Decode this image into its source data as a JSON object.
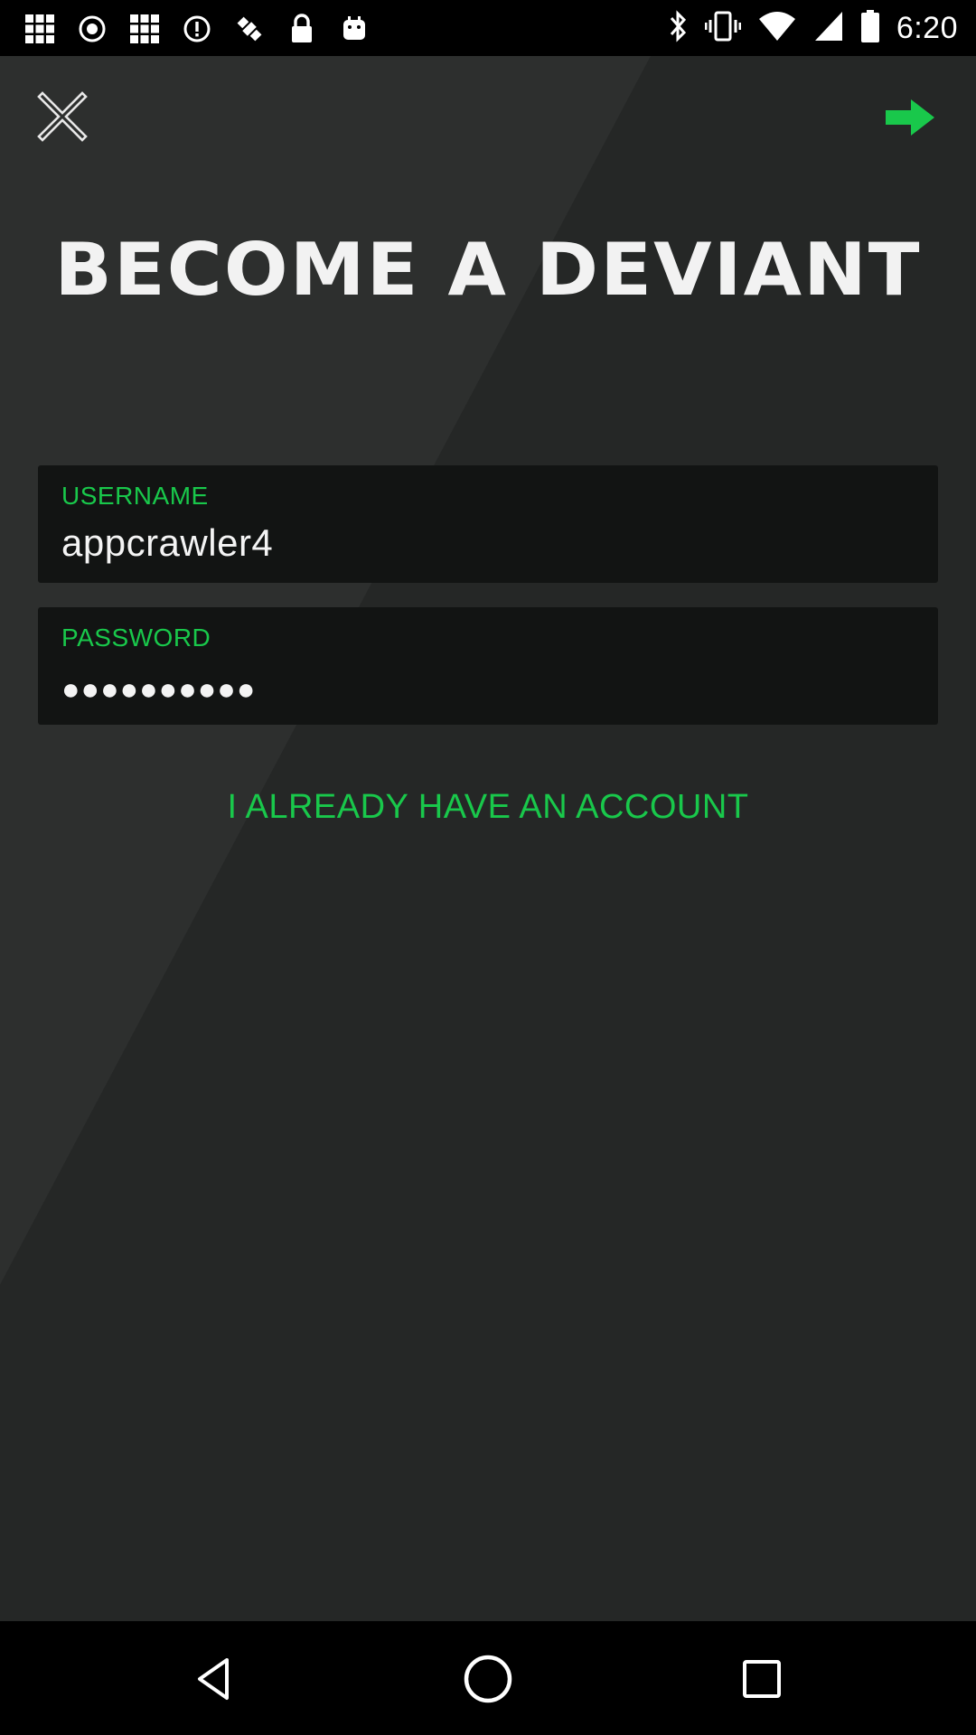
{
  "status_bar": {
    "time": "6:20",
    "left_icons": [
      "grid-icon",
      "record-icon",
      "grid-icon",
      "alert-icon",
      "satellite-icon",
      "lock-icon",
      "android-icon"
    ],
    "right_icons": [
      "bluetooth-icon",
      "vibrate-icon",
      "wifi-icon",
      "signal-icon",
      "battery-icon"
    ]
  },
  "header": {
    "close_icon": "close-icon",
    "next_icon": "arrow-right-icon"
  },
  "title": "BECOME A DEVIANT",
  "form": {
    "username_label": "USERNAME",
    "username_value": "appcrawler4",
    "password_label": "PASSWORD",
    "password_value": "●●●●●●●●●●"
  },
  "link_account": "I ALREADY HAVE AN ACCOUNT",
  "navigation": {
    "back_icon": "back-triangle-icon",
    "home_icon": "home-circle-icon",
    "recents_icon": "recents-square-icon"
  },
  "colors": {
    "accent": "#19c84b",
    "background": "#272928",
    "field_background": "#121413"
  }
}
